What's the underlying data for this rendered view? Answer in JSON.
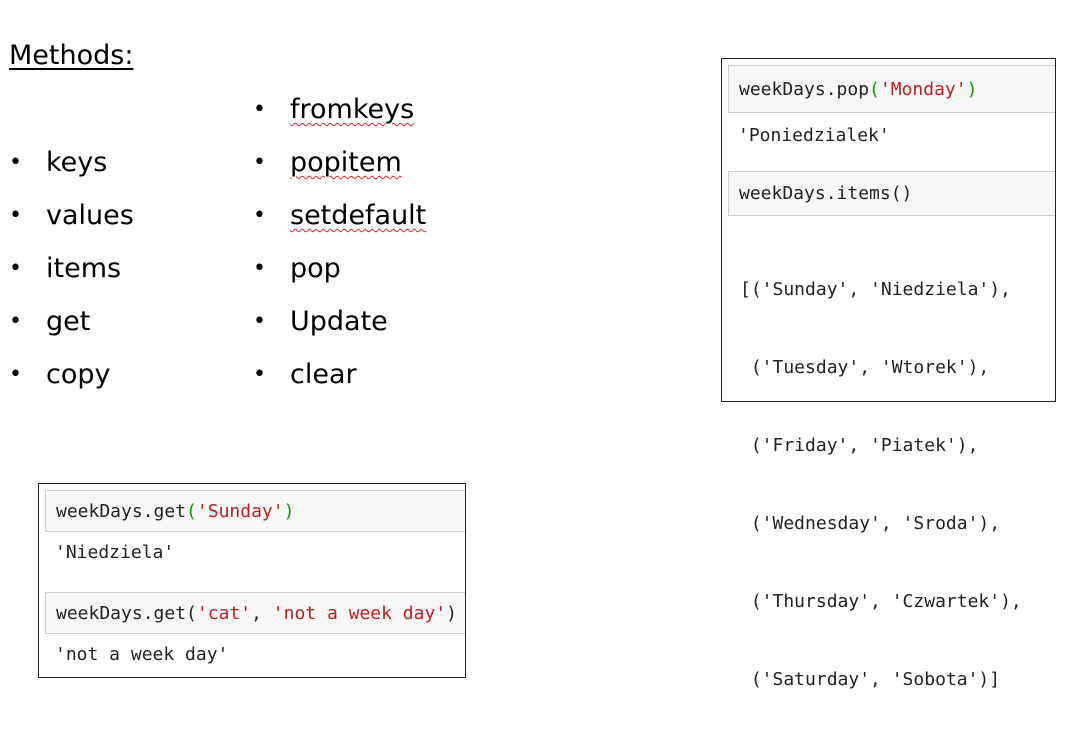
{
  "title": "Methods:",
  "methods_left": [
    "keys",
    "values",
    "items",
    "get",
    "copy"
  ],
  "methods_right": [
    "fromkeys",
    "popitem",
    "setdefault",
    "pop",
    "Update",
    "clear"
  ],
  "bullet": "•",
  "notebook_top": {
    "in1": {
      "prefix": "weekDays.pop",
      "open": "(",
      "arg": "'Monday'",
      "close": ")"
    },
    "out1": "'Poniedzialek'",
    "in2": "weekDays.items()",
    "out2_lines": [
      "[('Sunday', 'Niedziela'),",
      " ('Tuesday', 'Wtorek'),",
      " ('Friday', 'Piatek'),",
      " ('Wednesday', 'Sroda'),",
      " ('Thursday', 'Czwartek'),",
      " ('Saturday', 'Sobota')]"
    ]
  },
  "notebook_bottom": {
    "in1": {
      "prefix": "weekDays.get",
      "open": "(",
      "arg": "'Sunday'",
      "close": ")"
    },
    "out1": "'Niedziela'",
    "in2": {
      "prefix": "weekDays.get(",
      "arg1": "'cat'",
      "sep": ", ",
      "arg2": "'not a week day'",
      "close": ")"
    },
    "out2": "'not a week day'"
  }
}
